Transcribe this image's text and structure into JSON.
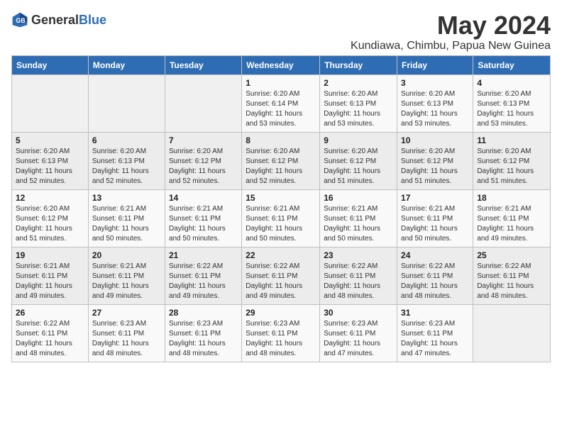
{
  "header": {
    "logo_general": "General",
    "logo_blue": "Blue",
    "title": "May 2024",
    "subtitle": "Kundiawa, Chimbu, Papua New Guinea"
  },
  "days_of_week": [
    "Sunday",
    "Monday",
    "Tuesday",
    "Wednesday",
    "Thursday",
    "Friday",
    "Saturday"
  ],
  "weeks": [
    [
      {
        "day": "",
        "info": ""
      },
      {
        "day": "",
        "info": ""
      },
      {
        "day": "",
        "info": ""
      },
      {
        "day": "1",
        "info": "Sunrise: 6:20 AM\nSunset: 6:14 PM\nDaylight: 11 hours\nand 53 minutes."
      },
      {
        "day": "2",
        "info": "Sunrise: 6:20 AM\nSunset: 6:13 PM\nDaylight: 11 hours\nand 53 minutes."
      },
      {
        "day": "3",
        "info": "Sunrise: 6:20 AM\nSunset: 6:13 PM\nDaylight: 11 hours\nand 53 minutes."
      },
      {
        "day": "4",
        "info": "Sunrise: 6:20 AM\nSunset: 6:13 PM\nDaylight: 11 hours\nand 53 minutes."
      }
    ],
    [
      {
        "day": "5",
        "info": "Sunrise: 6:20 AM\nSunset: 6:13 PM\nDaylight: 11 hours\nand 52 minutes."
      },
      {
        "day": "6",
        "info": "Sunrise: 6:20 AM\nSunset: 6:13 PM\nDaylight: 11 hours\nand 52 minutes."
      },
      {
        "day": "7",
        "info": "Sunrise: 6:20 AM\nSunset: 6:12 PM\nDaylight: 11 hours\nand 52 minutes."
      },
      {
        "day": "8",
        "info": "Sunrise: 6:20 AM\nSunset: 6:12 PM\nDaylight: 11 hours\nand 52 minutes."
      },
      {
        "day": "9",
        "info": "Sunrise: 6:20 AM\nSunset: 6:12 PM\nDaylight: 11 hours\nand 51 minutes."
      },
      {
        "day": "10",
        "info": "Sunrise: 6:20 AM\nSunset: 6:12 PM\nDaylight: 11 hours\nand 51 minutes."
      },
      {
        "day": "11",
        "info": "Sunrise: 6:20 AM\nSunset: 6:12 PM\nDaylight: 11 hours\nand 51 minutes."
      }
    ],
    [
      {
        "day": "12",
        "info": "Sunrise: 6:20 AM\nSunset: 6:12 PM\nDaylight: 11 hours\nand 51 minutes."
      },
      {
        "day": "13",
        "info": "Sunrise: 6:21 AM\nSunset: 6:11 PM\nDaylight: 11 hours\nand 50 minutes."
      },
      {
        "day": "14",
        "info": "Sunrise: 6:21 AM\nSunset: 6:11 PM\nDaylight: 11 hours\nand 50 minutes."
      },
      {
        "day": "15",
        "info": "Sunrise: 6:21 AM\nSunset: 6:11 PM\nDaylight: 11 hours\nand 50 minutes."
      },
      {
        "day": "16",
        "info": "Sunrise: 6:21 AM\nSunset: 6:11 PM\nDaylight: 11 hours\nand 50 minutes."
      },
      {
        "day": "17",
        "info": "Sunrise: 6:21 AM\nSunset: 6:11 PM\nDaylight: 11 hours\nand 50 minutes."
      },
      {
        "day": "18",
        "info": "Sunrise: 6:21 AM\nSunset: 6:11 PM\nDaylight: 11 hours\nand 49 minutes."
      }
    ],
    [
      {
        "day": "19",
        "info": "Sunrise: 6:21 AM\nSunset: 6:11 PM\nDaylight: 11 hours\nand 49 minutes."
      },
      {
        "day": "20",
        "info": "Sunrise: 6:21 AM\nSunset: 6:11 PM\nDaylight: 11 hours\nand 49 minutes."
      },
      {
        "day": "21",
        "info": "Sunrise: 6:22 AM\nSunset: 6:11 PM\nDaylight: 11 hours\nand 49 minutes."
      },
      {
        "day": "22",
        "info": "Sunrise: 6:22 AM\nSunset: 6:11 PM\nDaylight: 11 hours\nand 49 minutes."
      },
      {
        "day": "23",
        "info": "Sunrise: 6:22 AM\nSunset: 6:11 PM\nDaylight: 11 hours\nand 48 minutes."
      },
      {
        "day": "24",
        "info": "Sunrise: 6:22 AM\nSunset: 6:11 PM\nDaylight: 11 hours\nand 48 minutes."
      },
      {
        "day": "25",
        "info": "Sunrise: 6:22 AM\nSunset: 6:11 PM\nDaylight: 11 hours\nand 48 minutes."
      }
    ],
    [
      {
        "day": "26",
        "info": "Sunrise: 6:22 AM\nSunset: 6:11 PM\nDaylight: 11 hours\nand 48 minutes."
      },
      {
        "day": "27",
        "info": "Sunrise: 6:23 AM\nSunset: 6:11 PM\nDaylight: 11 hours\nand 48 minutes."
      },
      {
        "day": "28",
        "info": "Sunrise: 6:23 AM\nSunset: 6:11 PM\nDaylight: 11 hours\nand 48 minutes."
      },
      {
        "day": "29",
        "info": "Sunrise: 6:23 AM\nSunset: 6:11 PM\nDaylight: 11 hours\nand 48 minutes."
      },
      {
        "day": "30",
        "info": "Sunrise: 6:23 AM\nSunset: 6:11 PM\nDaylight: 11 hours\nand 47 minutes."
      },
      {
        "day": "31",
        "info": "Sunrise: 6:23 AM\nSunset: 6:11 PM\nDaylight: 11 hours\nand 47 minutes."
      },
      {
        "day": "",
        "info": ""
      }
    ]
  ]
}
